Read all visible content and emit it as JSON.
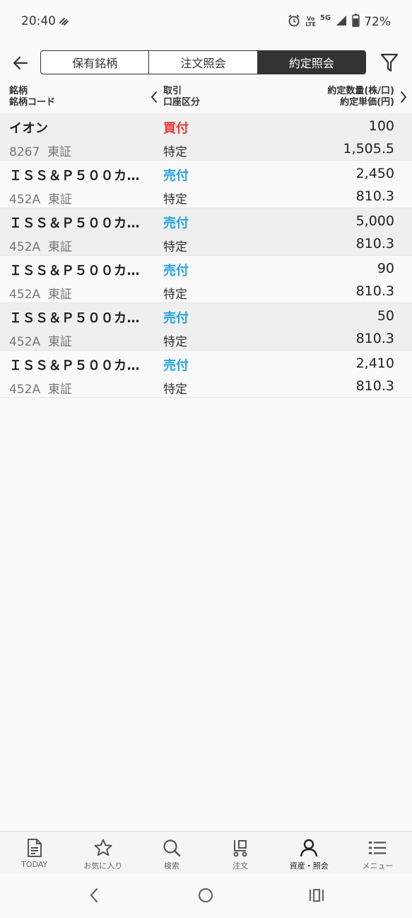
{
  "status_bar": {
    "time": "20:40",
    "battery": "72%",
    "volte_top": "Vo",
    "volte_bottom": "LTE",
    "network": "5G",
    "icons": [
      "signal-strength-icon",
      "alarm-icon",
      "battery-icon",
      "wifi-calling-icon"
    ]
  },
  "header": {
    "tabs": [
      {
        "label": "保有銘柄",
        "active": false
      },
      {
        "label": "注文照会",
        "active": false
      },
      {
        "label": "約定照会",
        "active": true
      }
    ],
    "icons": [
      "back-arrow-icon",
      "filter-icon"
    ]
  },
  "columns": {
    "name_line1": "銘柄",
    "name_line2": "銘柄コード",
    "trade_line1": "取引",
    "trade_line2": "口座区分",
    "exec_line1": "約定数量(株/口)",
    "exec_line2": "約定単価(円)"
  },
  "rows": [
    {
      "name": "イオン",
      "code": "8267",
      "market": "東証",
      "side": "買付",
      "side_type": "buy",
      "account": "特定",
      "qty": "100",
      "price": "1,505.5"
    },
    {
      "name": "ＩＳＳ＆Ｐ５００カ…",
      "code": "452A",
      "market": "東証",
      "side": "売付",
      "side_type": "sell",
      "account": "特定",
      "qty": "2,450",
      "price": "810.3"
    },
    {
      "name": "ＩＳＳ＆Ｐ５００カ…",
      "code": "452A",
      "market": "東証",
      "side": "売付",
      "side_type": "sell",
      "account": "特定",
      "qty": "5,000",
      "price": "810.3"
    },
    {
      "name": "ＩＳＳ＆Ｐ５００カ…",
      "code": "452A",
      "market": "東証",
      "side": "売付",
      "side_type": "sell",
      "account": "特定",
      "qty": "90",
      "price": "810.3"
    },
    {
      "name": "ＩＳＳ＆Ｐ５００カ…",
      "code": "452A",
      "market": "東証",
      "side": "売付",
      "side_type": "sell",
      "account": "特定",
      "qty": "50",
      "price": "810.3"
    },
    {
      "name": "ＩＳＳ＆Ｐ５００カ…",
      "code": "452A",
      "market": "東証",
      "side": "売付",
      "side_type": "sell",
      "account": "特定",
      "qty": "2,410",
      "price": "810.3"
    }
  ],
  "bottom_nav": [
    {
      "label": "TODAY",
      "icon": "document-icon"
    },
    {
      "label": "お気に入り",
      "icon": "star-icon"
    },
    {
      "label": "検索",
      "icon": "search-icon"
    },
    {
      "label": "注文",
      "icon": "cart-icon"
    },
    {
      "label": "資産・照会",
      "icon": "person-icon",
      "active": true
    },
    {
      "label": "メニュー",
      "icon": "menu-list-icon"
    }
  ],
  "colors": {
    "buy": "#e53935",
    "sell": "#29a3e0",
    "active_tab_bg": "#333333"
  }
}
